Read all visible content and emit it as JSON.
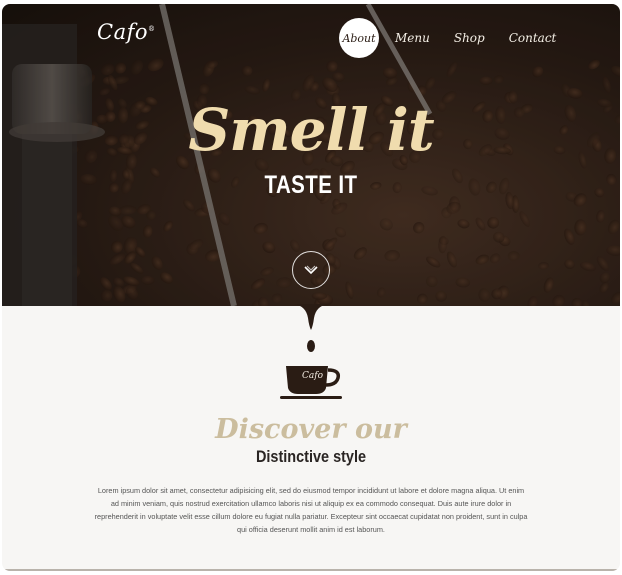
{
  "brand": {
    "logo": "Cafo",
    "mark": "®"
  },
  "nav": {
    "items": [
      "About",
      "Menu",
      "Shop",
      "Contact"
    ],
    "active": "About"
  },
  "hero": {
    "headline": "Smell it",
    "subheadline": "TASTE IT",
    "scroll_icon": "chevron-down-icon"
  },
  "cup": {
    "label": "Cafo"
  },
  "discover": {
    "script_heading": "Discover our",
    "heading": "Distinctive style"
  },
  "body_text": "Lorem ipsum dolor sit amet, consectetur adipisicing elit, sed do eiusmod tempor incididunt ut labore et dolore magna aliqua. Ut enim ad minim veniam, quis nostrud exercitation ullamco laboris nisi ut aliquip ex ea commodo consequat. Duis aute irure dolor in reprehenderit in voluptate velit esse cillum dolore eu fugiat nulla pariatur. Excepteur sint occaecat cupidatat non proident, sunt in culpa qui officia deserunt mollit anim id est laborum.",
  "colors": {
    "coffee_dark": "#2a1c14",
    "cream": "#f0dcae",
    "accent_script": "#cbbd9e",
    "page_bg": "#f7f6f4"
  }
}
